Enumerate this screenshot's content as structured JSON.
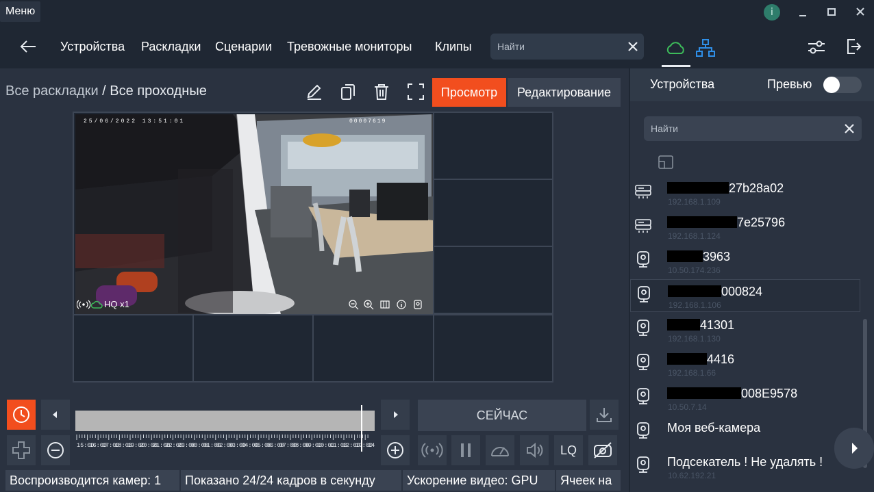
{
  "titlebar": {
    "menu_label": "Меню",
    "info_label": "i"
  },
  "nav": {
    "items": [
      "Устройства",
      "Раскладки",
      "Сценарии",
      "Тревожные мониторы",
      "Клипы"
    ],
    "search_placeholder": "Найти"
  },
  "breadcrumb": {
    "root": "Все раскладки",
    "separator": " / ",
    "current": "Все проходные"
  },
  "modes": {
    "view": "Просмотр",
    "edit": "Редактирование"
  },
  "video": {
    "osd_quality": "HQ x1",
    "osd_date": "25/06/2022  13:51:01",
    "osd_counter": "00007619"
  },
  "timeline": {
    "ticks": [
      "15:00",
      "16:00",
      "17:00",
      "18:00",
      "19:00",
      "20:00",
      "21:00",
      "22:00",
      "23:00",
      "00:00",
      "01:00",
      "02:00",
      "03:00",
      "04:00",
      "05:00",
      "06:00",
      "07:00",
      "08:00",
      "09:00",
      "10:00",
      "11:00",
      "12:00",
      "13:00",
      "14:00"
    ],
    "now_label": "СЕЙЧАС",
    "lq_label": "LQ"
  },
  "status": {
    "playing": "Воспроизводится камер: 1",
    "fps": "Показано 24/24 кадров в секунду",
    "accel": "Ускорение видео: GPU",
    "cells": "Ячеек на"
  },
  "right_panel": {
    "tab": "Устройства",
    "preview_label": "Превью",
    "preview_on": false,
    "search_placeholder": "Найти",
    "devices": [
      {
        "redact_w": 90,
        "name": "27b28a02",
        "ip": "192.168.1.109",
        "icon": "nvr-icon"
      },
      {
        "redact_w": 102,
        "name": "7e25796",
        "ip": "192.168.1.124",
        "icon": "nvr-icon"
      },
      {
        "redact_w": 52,
        "name": "3963",
        "ip": "10.50.174.236",
        "icon": "camera-icon"
      },
      {
        "redact_w": 78,
        "name": "000824",
        "ip": "192.168.1.106",
        "icon": "camera-icon",
        "selected": true
      },
      {
        "redact_w": 48,
        "name": "41301",
        "ip": "192.168.1.130",
        "icon": "camera-icon"
      },
      {
        "redact_w": 58,
        "name": "4416",
        "ip": "192.168.1.66",
        "icon": "camera-icon"
      },
      {
        "redact_w": 108,
        "name": "008E9578",
        "ip": "10.50.7.14",
        "icon": "camera-icon"
      },
      {
        "redact_w": 0,
        "name": "Моя веб-камера",
        "ip": "",
        "icon": "camera-icon"
      },
      {
        "redact_w": 0,
        "name": "Подсекатель ! Не удалять !",
        "ip": "10.62.192.21",
        "icon": "camera-icon"
      }
    ]
  },
  "colors": {
    "accent": "#f24e1e",
    "cloud": "#3dbb5a",
    "network": "#2f8fe8"
  }
}
